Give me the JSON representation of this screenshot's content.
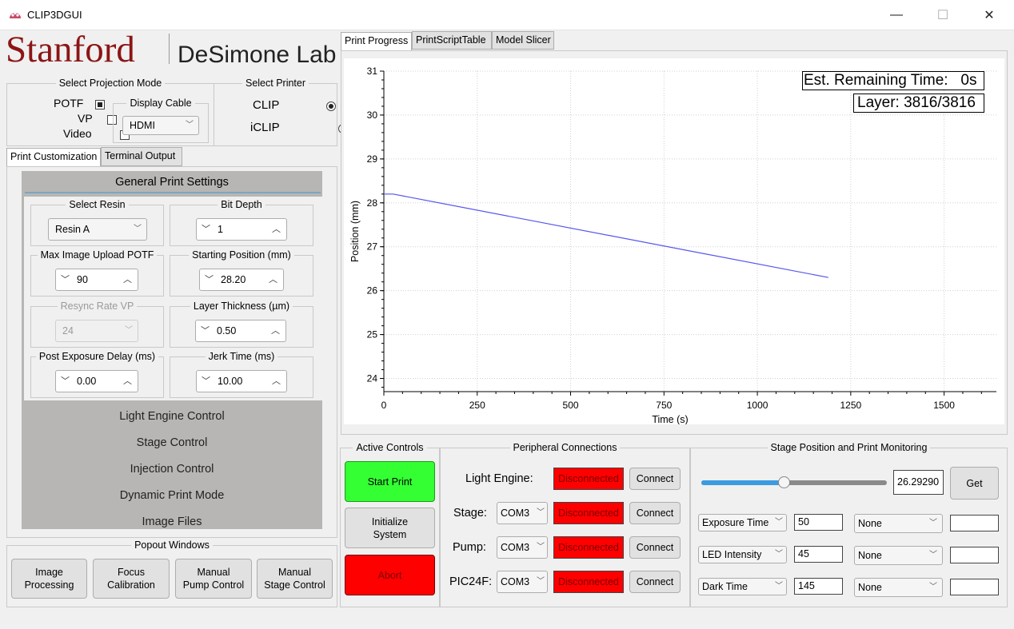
{
  "window": {
    "title": "CLIP3DGUI",
    "min": "—",
    "max": "☐",
    "close": "✕"
  },
  "logo": {
    "left": "Stanford",
    "right": "DeSimone Lab"
  },
  "projection": {
    "title": "Select Projection Mode",
    "options": [
      {
        "label": "POTF",
        "checked": true
      },
      {
        "label": "VP",
        "checked": false
      },
      {
        "label": "Video",
        "checked": false
      }
    ],
    "display_cable": {
      "title": "Display Cable",
      "value": "HDMI"
    }
  },
  "printer": {
    "title": "Select Printer",
    "options": [
      {
        "label": "CLIP",
        "selected": true
      },
      {
        "label": "iCLIP",
        "selected": false
      }
    ]
  },
  "left_tabs": [
    "Print Customization",
    "Terminal Output"
  ],
  "general": {
    "title": "General Print Settings",
    "fields": [
      {
        "label": "Select Resin",
        "value": "Resin A"
      },
      {
        "label": "Bit Depth",
        "value": "1"
      },
      {
        "label": "Max Image Upload POTF",
        "value": "90"
      },
      {
        "label": "Starting Position (mm)",
        "value": "28.20"
      },
      {
        "label": "Resync Rate VP",
        "value": "24"
      },
      {
        "label": "Layer Thickness (µm)",
        "value": "0.50"
      },
      {
        "label": "Post Exposure Delay (ms)",
        "value": "0.00"
      },
      {
        "label": "Jerk Time (ms)",
        "value": "10.00"
      }
    ]
  },
  "sections": [
    "Light Engine Control",
    "Stage Control",
    "Injection Control",
    "Dynamic Print Mode",
    "Image Files"
  ],
  "popout": {
    "title": "Popout Windows",
    "buttons": [
      "Image\nProcessing",
      "Focus\nCalibration",
      "Manual\nPump Control",
      "Manual\nStage Control"
    ]
  },
  "right_tabs": [
    "Print Progress",
    "PrintScriptTable",
    "Model Slicer"
  ],
  "chart_data": {
    "type": "line",
    "xlabel": "Time (s)",
    "ylabel": "Position (mm)",
    "xlim": [
      0,
      1640
    ],
    "ylim": [
      23.7,
      31
    ],
    "xticks": [
      0,
      250,
      500,
      750,
      1000,
      1250,
      1500
    ],
    "yticks": [
      24,
      25,
      26,
      27,
      28,
      29,
      30,
      31
    ],
    "grid": true,
    "series": [
      {
        "x": [
          0,
          25,
          1190
        ],
        "y": [
          28.2,
          28.2,
          26.3
        ],
        "color": "#5555ee"
      }
    ],
    "annotations": [
      "Est. Remaining Time:   0s",
      "Layer: 3816/3816"
    ]
  },
  "active_controls": {
    "title": "Active Controls",
    "start": "Start Print",
    "init": "Initialize\nSystem",
    "abort": "Abort"
  },
  "peripheral": {
    "title": "Peripheral Connections",
    "rows": [
      {
        "label": "Light Engine:",
        "port": "",
        "status": "Disconnected",
        "button": "Connect"
      },
      {
        "label": "Stage:",
        "port": "COM3",
        "status": "Disconnected",
        "button": "Connect"
      },
      {
        "label": "Pump:",
        "port": "COM3",
        "status": "Disconnected",
        "button": "Connect"
      },
      {
        "label": "PIC24F:",
        "port": "COM3",
        "status": "Disconnected",
        "button": "Connect"
      }
    ]
  },
  "monitor": {
    "title": "Stage Position and Print Monitoring",
    "slider_fraction": 0.45,
    "position": "26.29290",
    "get": "Get",
    "rows": [
      {
        "param": "Exposure Time",
        "value": "50",
        "mode": "None",
        "extra": ""
      },
      {
        "param": "LED Intensity",
        "value": "45",
        "mode": "None",
        "extra": ""
      },
      {
        "param": "Dark Time",
        "value": "145",
        "mode": "None",
        "extra": ""
      }
    ]
  }
}
